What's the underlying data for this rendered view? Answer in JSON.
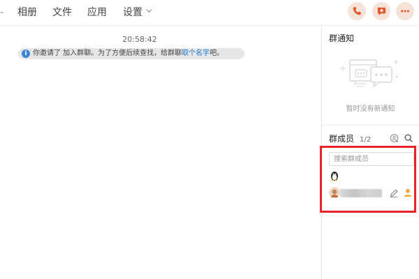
{
  "header": {
    "tabs": [
      {
        "label": "相册"
      },
      {
        "label": "文件"
      },
      {
        "label": "应用"
      },
      {
        "label": "设置"
      }
    ],
    "leading_glyph": "-",
    "actions": [
      {
        "icon": "phone-icon",
        "color": "#e2572a"
      },
      {
        "icon": "add-chat-icon",
        "color": "#e2572a"
      },
      {
        "icon": "more-icon",
        "color": "#e2572a"
      }
    ]
  },
  "chat": {
    "timestamp": "20:58:42",
    "notice": {
      "prefix": "你邀请了   加入群聊。为了方便后续查找，给群聊",
      "link": "取个名字",
      "suffix": "吧。"
    }
  },
  "side_panel": {
    "notice_section": {
      "title": "群通知",
      "empty_text": "暂时没有新通知"
    },
    "members_section": {
      "title": "群成员",
      "count": "1/2",
      "search_placeholder": "搜索群成员",
      "members": [
        {
          "avatar": "qq-penguin-icon"
        },
        {
          "avatar": "user-avatar",
          "actions": [
            "edit-icon",
            "admin-icon"
          ]
        }
      ]
    }
  },
  "colors": {
    "accent": "#e2572a",
    "link": "#1a76d2",
    "highlight": "#e8242b",
    "info": "#3a86d4"
  }
}
